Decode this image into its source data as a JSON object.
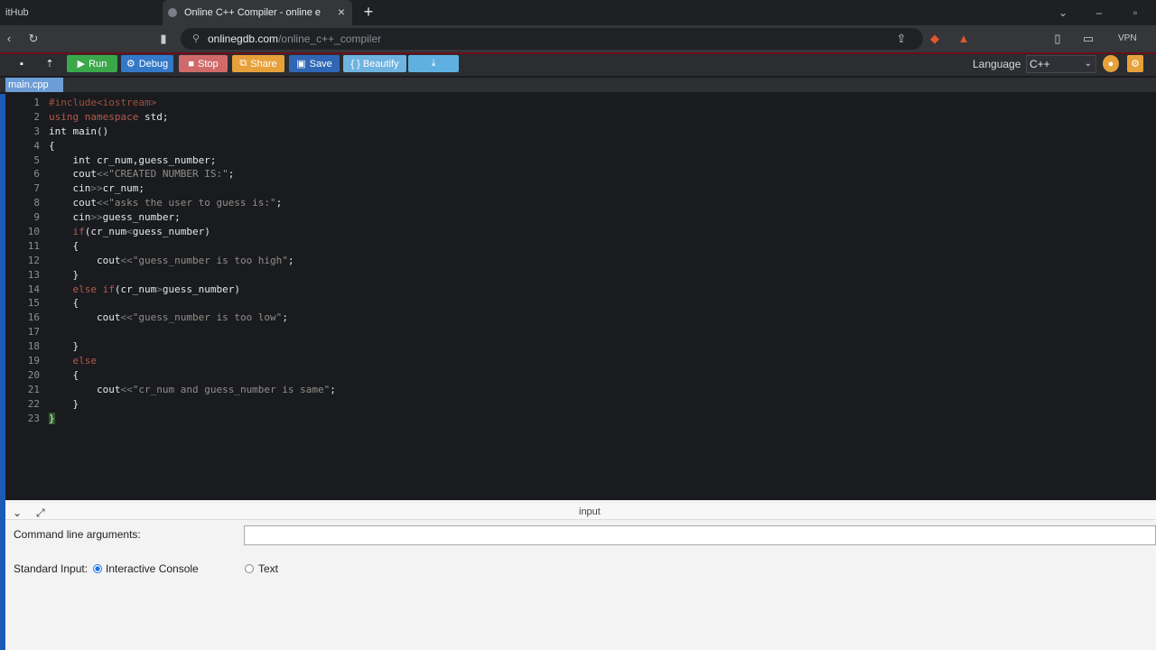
{
  "browser": {
    "prev_tab_label": "itHub",
    "active_tab_label": "Online C++ Compiler - online e",
    "url_host": "onlinegdb.com",
    "url_path": "/online_c++_compiler",
    "vpn_label": "VPN"
  },
  "toolbar": {
    "run": "Run",
    "debug": "Debug",
    "stop": "Stop",
    "share": "Share",
    "save": "Save",
    "beautify": "{ } Beautify",
    "language_label": "Language",
    "language_value": "C++"
  },
  "file_tab": "main.cpp",
  "editor": {
    "line_numbers": [
      "1",
      "2",
      "3",
      "4",
      "5",
      "6",
      "7",
      "8",
      "9",
      "10",
      "11",
      "12",
      "13",
      "14",
      "15",
      "16",
      "17",
      "18",
      "19",
      "20",
      "21",
      "22",
      "23"
    ]
  },
  "input_panel": {
    "title": "input",
    "cmd_label": "Command line arguments:",
    "cmd_value": "",
    "stdin_label": "Standard Input:",
    "option_interactive": "Interactive Console",
    "option_text": "Text"
  },
  "colors": {
    "run": "#3aa84a",
    "debug": "#3478c9",
    "stop": "#d06a6a",
    "share": "#e6a13a",
    "save": "#2f66b5",
    "beautify": "#6fb3e0",
    "upload": "#5fb0e0",
    "accent": "#1b5bb5"
  }
}
